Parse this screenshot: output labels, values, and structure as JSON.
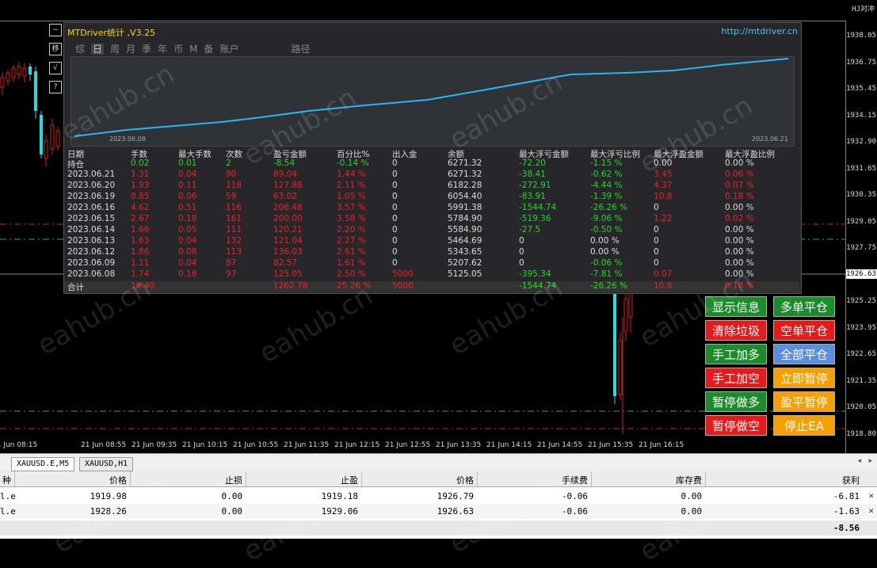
{
  "panel": {
    "title": "MTDriver统计 ,V3.25",
    "url": "http://mtdriver.cn",
    "tabs": [
      "综",
      "日",
      "周",
      "月",
      "季",
      "年",
      "币",
      "M",
      "备",
      "账户"
    ],
    "path_label": "路径",
    "curve_start_date": "2023.06.08",
    "curve_end_date": "2023.06.21",
    "headers": [
      "日期",
      "手数",
      "最大手数",
      "次数",
      "盈亏金额",
      "百分比%",
      "出入金",
      "余额",
      "最大浮亏金额",
      "最大浮亏比例",
      "最大浮盈金额",
      "最大浮盈比例"
    ],
    "holding_row": [
      "持仓",
      "0.02",
      "0.01",
      "2",
      "-8.54",
      "-0.14 %",
      "0",
      "6271.32",
      "-72.20",
      "-1.15 %",
      "0.00",
      "0.00 %"
    ],
    "rows": [
      [
        "2023.06.21",
        "1.31",
        "0.04",
        "90",
        "89.04",
        "1.44 %",
        "0",
        "6271.32",
        "-38.41",
        "-0.62 %",
        "3.45",
        "0.06 %"
      ],
      [
        "2023.06.20",
        "1.93",
        "0.11",
        "118",
        "127.88",
        "2.11 %",
        "0",
        "6182.28",
        "-272.91",
        "-4.44 %",
        "4.37",
        "0.07 %"
      ],
      [
        "2023.06.19",
        "0.85",
        "0.06",
        "59",
        "63.02",
        "1.05 %",
        "0",
        "6054.40",
        "-83.91",
        "-1.39 %",
        "10.8",
        "0.18 %"
      ],
      [
        "2023.06.16",
        "4.62",
        "0.51",
        "116",
        "206.48",
        "3.57 %",
        "0",
        "5991.38",
        "-1544.74",
        "-26.26 %",
        "0",
        "0.00 %"
      ],
      [
        "2023.06.15",
        "2.67",
        "0.18",
        "161",
        "200.00",
        "3.58 %",
        "0",
        "5784.90",
        "-519.36",
        "-9.06 %",
        "1.22",
        "0.02 %"
      ],
      [
        "2023.06.14",
        "1.66",
        "0.05",
        "111",
        "120.21",
        "2.20 %",
        "0",
        "5584.90",
        "-27.5",
        "-0.50 %",
        "0",
        "0.00 %"
      ],
      [
        "2023.06.13",
        "1.63",
        "0.04",
        "132",
        "121.04",
        "2.27 %",
        "0",
        "5464.69",
        "0",
        "0.00 %",
        "0",
        "0.00 %"
      ],
      [
        "2023.06.12",
        "1.86",
        "0.08",
        "113",
        "136.03",
        "2.61 %",
        "0",
        "5343.65",
        "0",
        "0.00 %",
        "0",
        "0.00 %"
      ],
      [
        "2023.06.09",
        "1.11",
        "0.04",
        "87",
        "82.57",
        "1.61 %",
        "0",
        "5207.62",
        "0",
        "-0.06 %",
        "0",
        "0.00 %"
      ],
      [
        "2023.06.08",
        "1.74",
        "0.18",
        "97",
        "125.05",
        "2.50 %",
        "5000",
        "5125.05",
        "-395.34",
        "-7.81 %",
        "0.07",
        "0.00 %"
      ]
    ],
    "total_row": [
      "合计",
      "19.40",
      "",
      "",
      "1262.78",
      "25.26 %",
      "5000",
      "",
      "-1544.74",
      "-26.26 %",
      "10.8",
      "0.18 %"
    ]
  },
  "side_buttons": [
    "−",
    "移",
    "√",
    "?"
  ],
  "top_right_label": "HJ对冲",
  "price_axis": {
    "ticks": [
      "1938.05",
      "1936.75",
      "1935.45",
      "1934.15",
      "1932.90",
      "1931.65",
      "1930.35",
      "1929.05",
      "1927.75",
      "1926.45",
      "1925.25",
      "1923.95",
      "1922.65",
      "1921.35",
      "1920.05",
      "1918.80"
    ],
    "current_price": "1926.63"
  },
  "time_axis": [
    "21 Jun 08:15",
    "21 Jun 08:55",
    "21 Jun 09:35",
    "21 Jun 10:15",
    "21 Jun 10:55",
    "21 Jun 11:35",
    "21 Jun 12:15",
    "21 Jun 12:55",
    "21 Jun 13:35",
    "21 Jun 14:15",
    "21 Jun 14:55",
    "21 Jun 15:35",
    "21 Jun 16:15"
  ],
  "action_buttons": [
    {
      "label": "显示信息",
      "color": "#1a8c2a"
    },
    {
      "label": "多单平仓",
      "color": "#1a8c2a"
    },
    {
      "label": "清除垃圾",
      "color": "#e8191a"
    },
    {
      "label": "空单平仓",
      "color": "#e8191a"
    },
    {
      "label": "手工加多",
      "color": "#1a8c2a"
    },
    {
      "label": "全部平仓",
      "color": "#5a8ee0"
    },
    {
      "label": "手工加空",
      "color": "#e8191a"
    },
    {
      "label": "立即暂停",
      "color": "#f5a000"
    },
    {
      "label": "暂停做多",
      "color": "#1a8c2a"
    },
    {
      "label": "盈平暂停",
      "color": "#f5a000"
    },
    {
      "label": "暂停做空",
      "color": "#e8191a"
    },
    {
      "label": "停止EA",
      "color": "#f5a000"
    }
  ],
  "chart_tabs": [
    "XAUUSD.E,M5",
    "XAUUSD,H1"
  ],
  "orders": {
    "headers": [
      "种",
      "价格",
      "止损",
      "止盈",
      "价格",
      "手续费",
      "库存费",
      "获利"
    ],
    "rows": [
      [
        "l.e",
        "1919.98",
        "0.00",
        "1919.18",
        "1926.79",
        "-0.06",
        "0.00",
        "-6.81"
      ],
      [
        "l.e",
        "1928.26",
        "0.00",
        "1929.06",
        "1926.63",
        "-0.06",
        "0.00",
        "-1.63"
      ]
    ],
    "total": "-8.56"
  },
  "watermark": "eahub.cn"
}
